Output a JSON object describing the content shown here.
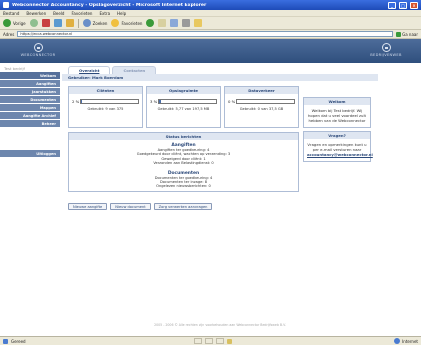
{
  "window": {
    "title": "Webconnector Accountancy - Opslagoverzicht - Microsoft Internet Explorer"
  },
  "menu": [
    "Bestand",
    "Bewerken",
    "Beeld",
    "Favorieten",
    "Extra",
    "Help"
  ],
  "toolbar": {
    "back_label": "Vorige",
    "search_label": "Zoeken",
    "favorites_label": "Favorieten"
  },
  "address": {
    "label": "Adres",
    "value": "https://ecca.webconnector.nl",
    "go_label": "Ga naar"
  },
  "banner": {
    "left_logo": "WEBCONNECTOR",
    "right_logo": "BEDRIJVENWEB"
  },
  "sidebar": {
    "user": "Test bedrijf",
    "items": [
      {
        "label": "Welkom"
      },
      {
        "label": "Aangiften"
      },
      {
        "label": "Jaarstukken"
      },
      {
        "label": "Documenten"
      },
      {
        "label": "Mappen"
      },
      {
        "label": "Aangifte Archief"
      },
      {
        "label": "Beheer"
      }
    ],
    "logout": "Uitloggen"
  },
  "tabs": [
    "Overzicht",
    "Contacten"
  ],
  "user_line": "Gebruiker: Mark Boerdam",
  "stats": [
    {
      "title": "Cliënten",
      "percent_text": "2 %",
      "percent": 2,
      "usage": "Gebruikt: 9 van 375"
    },
    {
      "title": "Opslagruimte",
      "percent_text": "3 %",
      "percent": 3,
      "usage": "Gebruikt: 5,77 van 197,5 MB"
    },
    {
      "title": "Dataverkeer",
      "percent_text": "0 %",
      "percent": 0,
      "usage": "Gebruikt: 0 van 37,5 GB"
    }
  ],
  "welcome": {
    "title": "Welkom",
    "text": "Welkom bij Test bedrijf. Wij hopen dat u veel voordeel zult hebben van de Webconnector"
  },
  "questions": {
    "title": "Vragen?",
    "text": "Vragen en opmerkingen kunt u per e-mail versturen naar",
    "email": "accountancy@webconnector.nl"
  },
  "status": {
    "title": "Status berichten",
    "sections": [
      {
        "title": "Aangiften",
        "lines": [
          "Aangiften ter goedkeuring: 4",
          "Goedgekeurd door cliënt, wachten op verzending: 3",
          "Geweigerd door cliënt: 1",
          "Verzonden aan Belastingdienst: 0"
        ]
      },
      {
        "title": "Documenten",
        "lines": [
          "Documenten ter goedkeuring: 4",
          "Documenten ter inzage: 8",
          "Ongelezen nieuwsberichten: 0"
        ]
      }
    ]
  },
  "actions": [
    "Nieuwe aangifte",
    "Nieuw document",
    "Zorg verwerken aanvragen"
  ],
  "footer": "2005 - 2006 © Alle rechten zijn voorbehouden aan Webconnector Bedrijfsweb B.V.",
  "statusbar": {
    "text": "Gereed",
    "zone": "Internet"
  },
  "colors": {
    "nav": "#6d86ad",
    "banner": "#3f5f8d",
    "panel_head": "#dfe6f1",
    "accent": "#2d4a7a"
  }
}
